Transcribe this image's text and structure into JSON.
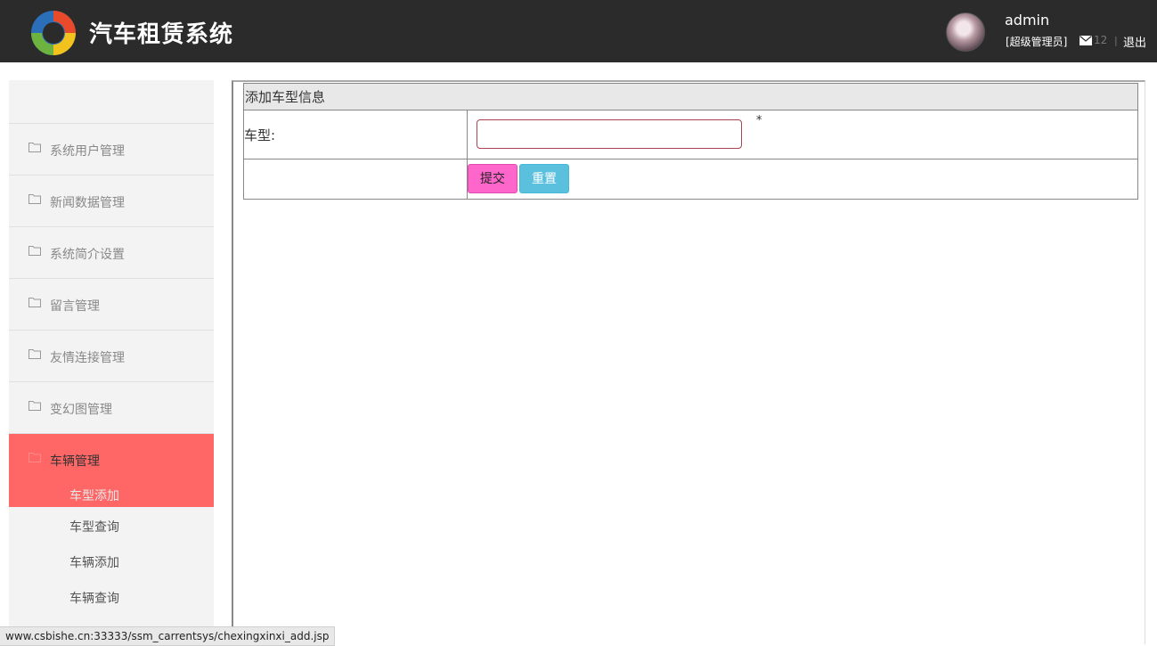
{
  "header": {
    "title": "汽车租赁系统",
    "username": "admin",
    "role": "[超级管理员]",
    "mail_count": "12",
    "separator": "|",
    "logout_label": "退出"
  },
  "sidebar": {
    "items": [
      {
        "label": "系统用户管理"
      },
      {
        "label": "新闻数据管理"
      },
      {
        "label": "系统简介设置"
      },
      {
        "label": "留言管理"
      },
      {
        "label": "友情连接管理"
      },
      {
        "label": "变幻图管理"
      }
    ],
    "active_group": {
      "label": "车辆管理",
      "active_sub": "车型添加",
      "subs": [
        {
          "label": "车型查询"
        },
        {
          "label": "车辆添加"
        },
        {
          "label": "车辆查询"
        }
      ]
    }
  },
  "form": {
    "title": "添加车型信息",
    "field_label": "车型:",
    "field_value": "",
    "required_mark": "*",
    "submit_label": "提交",
    "reset_label": "重置"
  },
  "status_bar": {
    "url": "www.csbishe.cn:33333/ssm_carrentsys/chexingxinxi_add.jsp"
  },
  "colors": {
    "header_bg": "#2b2b2b",
    "sidebar_bg": "#f3f3f3",
    "active_menu": "#ff6666",
    "submit_button": "#ff66cc",
    "reset_button": "#5bc0de"
  }
}
